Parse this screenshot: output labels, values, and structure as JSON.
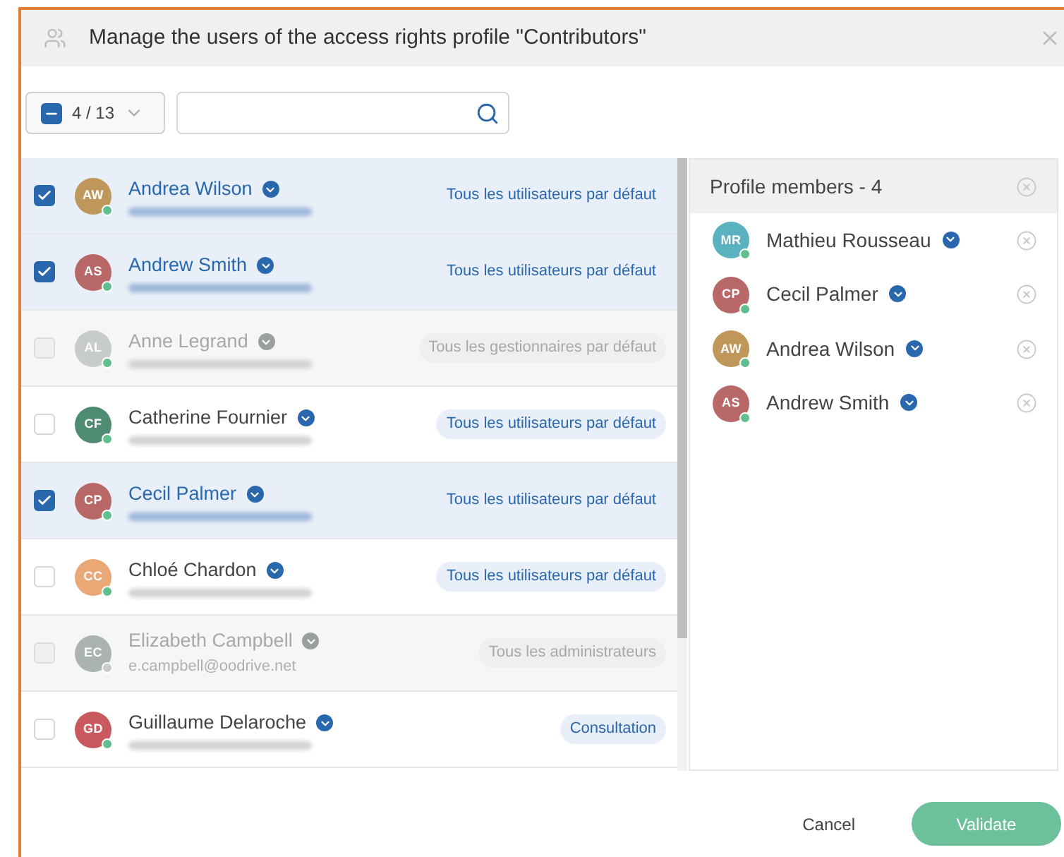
{
  "dialog": {
    "title": "Manage the users of the access rights profile \"Contributors\""
  },
  "toolbar": {
    "selection_count": "4 / 13",
    "selection_partial": true
  },
  "users": [
    {
      "initials": "AW",
      "color": "#c0975a",
      "name": "Andrea Wilson",
      "email_blurred": true,
      "profile": "Tous les utilisateurs par défaut",
      "selected": true,
      "disabled": false
    },
    {
      "initials": "AS",
      "color": "#b96868",
      "name": "Andrew Smith",
      "email_blurred": true,
      "profile": "Tous les utilisateurs par défaut",
      "selected": true,
      "disabled": false
    },
    {
      "initials": "AL",
      "color": "#c8ccc8",
      "name": "Anne Legrand",
      "email_blurred": true,
      "profile": "Tous les gestionnaires par défaut",
      "selected": false,
      "disabled": true
    },
    {
      "initials": "CF",
      "color": "#4f8a72",
      "name": "Catherine Fournier",
      "email_blurred": true,
      "profile": "Tous les utilisateurs par défaut",
      "selected": false,
      "disabled": false
    },
    {
      "initials": "CP",
      "color": "#b96868",
      "name": "Cecil Palmer",
      "email_blurred": true,
      "profile": "Tous les utilisateurs par défaut",
      "selected": true,
      "disabled": false
    },
    {
      "initials": "CC",
      "color": "#eaa877",
      "name": "Chloé Chardon",
      "email_blurred": true,
      "profile": "Tous les utilisateurs par défaut",
      "selected": false,
      "disabled": false
    },
    {
      "initials": "EC",
      "color": "#aab3ae",
      "name": "Elizabeth Campbell",
      "email": "e.campbell@oodrive.net",
      "profile": "Tous les administrateurs",
      "selected": false,
      "disabled": true
    },
    {
      "initials": "GD",
      "color": "#c9595f",
      "name": "Guillaume Delaroche",
      "email_blurred": true,
      "profile": "Consultation",
      "selected": false,
      "disabled": false
    }
  ],
  "members": {
    "title": "Profile members - 4",
    "items": [
      {
        "initials": "MR",
        "color": "#5ab1c0",
        "name": "Mathieu Rousseau"
      },
      {
        "initials": "CP",
        "color": "#b96868",
        "name": "Cecil Palmer"
      },
      {
        "initials": "AW",
        "color": "#c0975a",
        "name": "Andrea Wilson"
      },
      {
        "initials": "AS",
        "color": "#b96868",
        "name": "Andrew Smith"
      }
    ]
  },
  "buttons": {
    "cancel": "Cancel",
    "validate": "Validate"
  }
}
